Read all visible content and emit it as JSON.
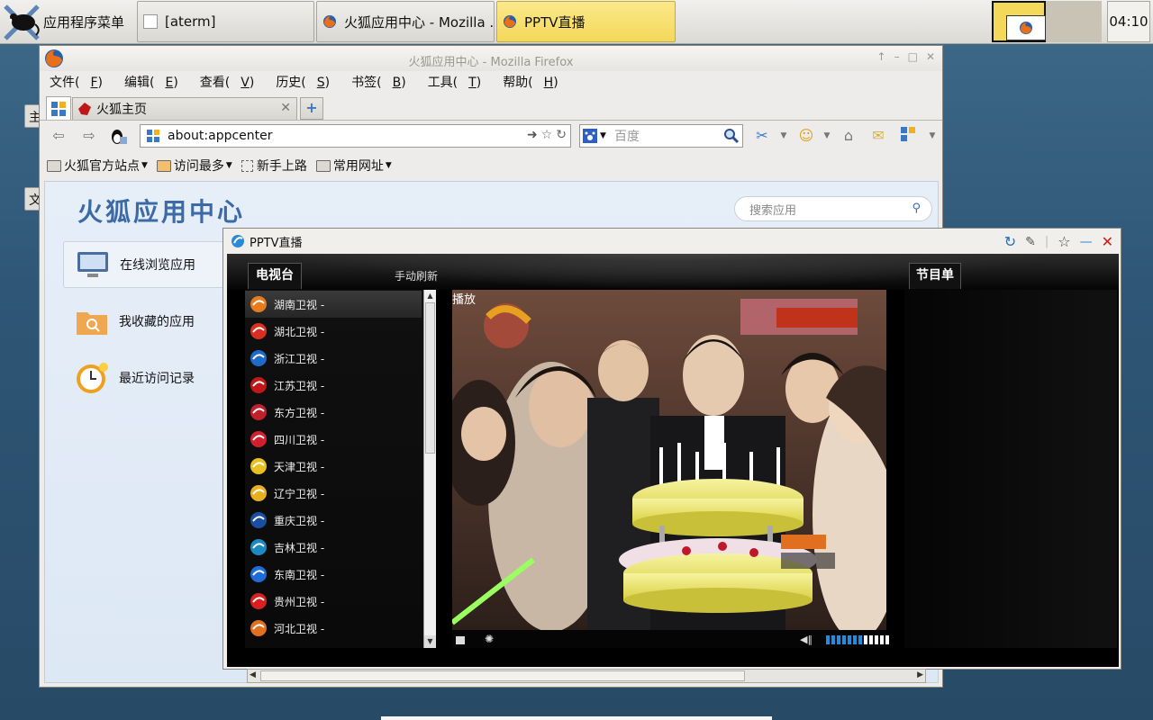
{
  "taskbar": {
    "menu_label": "应用程序菜单",
    "tasks": [
      "[aterm]",
      "火狐应用中心 - Mozilla ...",
      "PPTV直播"
    ],
    "clock": "04:10"
  },
  "desktop": {
    "peek1": "主",
    "peek2": "文"
  },
  "firefox": {
    "window_title": "火狐应用中心 - Mozilla Firefox",
    "menu": [
      {
        "label": "文件(",
        "key": "F",
        "end": ")"
      },
      {
        "label": "编辑(",
        "key": "E",
        "end": ")"
      },
      {
        "label": "查看(",
        "key": "V",
        "end": ")"
      },
      {
        "label": "历史(",
        "key": "S",
        "end": ")"
      },
      {
        "label": "书签(",
        "key": "B",
        "end": ")"
      },
      {
        "label": "工具(",
        "key": "T",
        "end": ")"
      },
      {
        "label": "帮助(",
        "key": "H",
        "end": ")"
      }
    ],
    "tab_label": "火狐主页",
    "url": "about:appcenter",
    "search_placeholder": "百度",
    "bookmarks": [
      "火狐官方站点",
      "访问最多",
      "新手上路",
      "常用网址"
    ],
    "page": {
      "title": "火狐应用中心",
      "search_placeholder": "搜索应用",
      "sidebar": [
        "在线浏览应用",
        "我收藏的应用",
        "最近访问记录"
      ]
    }
  },
  "pptv": {
    "window_title": "PPTV直播",
    "tv_tab": "电视台",
    "refresh": "手动刷新",
    "schedule_tab": "节目单",
    "play_label": "播放",
    "channels": [
      "湖南卫视 -",
      "湖北卫视 -",
      "浙江卫视 -",
      "江苏卫视 -",
      "东方卫视 -",
      "四川卫视 -",
      "天津卫视 -",
      "辽宁卫视 -",
      "重庆卫视 -",
      "吉林卫视 -",
      "东南卫视 -",
      "贵州卫视 -",
      "河北卫视 -"
    ],
    "selected_channel": 0,
    "volume_level": 0.6,
    "colors": {
      "accent": "#1f8de0",
      "highlight": "#f4d85a"
    }
  }
}
